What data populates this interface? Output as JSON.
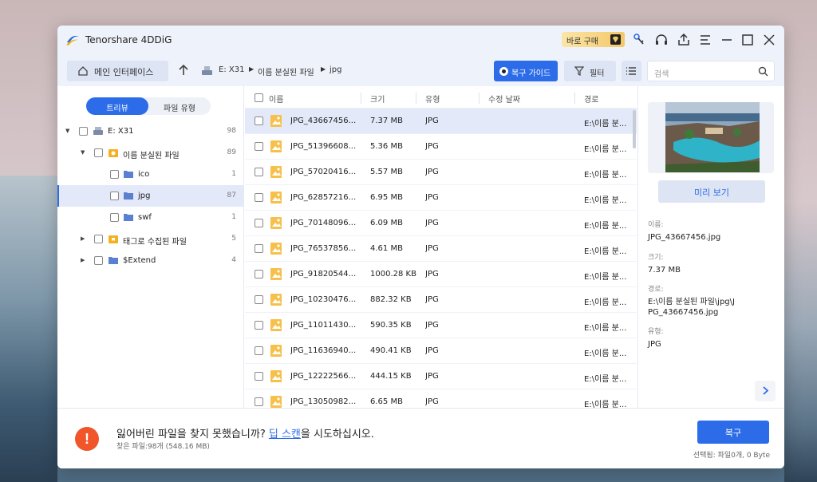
{
  "app": {
    "title": "Tenorshare 4DDiG",
    "buy_label": "바로 구매"
  },
  "toolbar": {
    "home_label": "메인 인터페이스",
    "breadcrumb": [
      "E: X31",
      "이름 분실된 파일",
      "jpg"
    ],
    "guide_label": "복구 가이드",
    "filter_label": "필터",
    "search_placeholder": "검색"
  },
  "sidebar": {
    "tab_tree": "트리뷰",
    "tab_type": "파일 유형",
    "items": [
      {
        "label": "E: X31",
        "count": "98"
      },
      {
        "label": "이름 분실된 파일",
        "count": "89"
      },
      {
        "label": "ico",
        "count": "1"
      },
      {
        "label": "jpg",
        "count": "87"
      },
      {
        "label": "swf",
        "count": "1"
      },
      {
        "label": "태그로 수집된 파일",
        "count": "5"
      },
      {
        "label": "$Extend",
        "count": "4"
      }
    ]
  },
  "list": {
    "columns": [
      "이름",
      "크기",
      "유형",
      "수정 날짜",
      "경로"
    ],
    "rows": [
      {
        "name": "JPG_43667456...",
        "size": "7.37 MB",
        "type": "JPG",
        "date": "",
        "path": "E:\\이름 분..."
      },
      {
        "name": "JPG_51396608...",
        "size": "5.36 MB",
        "type": "JPG",
        "date": "",
        "path": "E:\\이름 분..."
      },
      {
        "name": "JPG_57020416...",
        "size": "5.57 MB",
        "type": "JPG",
        "date": "",
        "path": "E:\\이름 분..."
      },
      {
        "name": "JPG_62857216...",
        "size": "6.95 MB",
        "type": "JPG",
        "date": "",
        "path": "E:\\이름 분..."
      },
      {
        "name": "JPG_70148096...",
        "size": "6.09 MB",
        "type": "JPG",
        "date": "",
        "path": "E:\\이름 분..."
      },
      {
        "name": "JPG_76537856...",
        "size": "4.61 MB",
        "type": "JPG",
        "date": "",
        "path": "E:\\이름 분..."
      },
      {
        "name": "JPG_91820544...",
        "size": "1000.28 KB",
        "type": "JPG",
        "date": "",
        "path": "E:\\이름 분..."
      },
      {
        "name": "JPG_10230476...",
        "size": "882.32 KB",
        "type": "JPG",
        "date": "",
        "path": "E:\\이름 분..."
      },
      {
        "name": "JPG_11011430...",
        "size": "590.35 KB",
        "type": "JPG",
        "date": "",
        "path": "E:\\이름 분..."
      },
      {
        "name": "JPG_11636940...",
        "size": "490.41 KB",
        "type": "JPG",
        "date": "",
        "path": "E:\\이름 분..."
      },
      {
        "name": "JPG_12222566...",
        "size": "444.15 KB",
        "type": "JPG",
        "date": "",
        "path": "E:\\이름 분..."
      },
      {
        "name": "JPG_13050982...",
        "size": "6.65 MB",
        "type": "JPG",
        "date": "",
        "path": "E:\\이름 분..."
      }
    ]
  },
  "details": {
    "preview_label": "미리 보기",
    "name_label": "이름:",
    "name_value": "JPG_43667456.jpg",
    "size_label": "크기:",
    "size_value": "7.37 MB",
    "path_label": "경로:",
    "path_value": "E:\\이름 분실된 파일\\jpg\\JPG_43667456.jpg",
    "type_label": "유형:",
    "type_value": "JPG"
  },
  "footer": {
    "message_before": "잃어버린 파일을 찾지 못했습니까? ",
    "deep_scan_link": "딥 스캔",
    "message_after": "을 시도하십시오.",
    "found_text": "찾은 파일:98개 (548.16 MB)",
    "recover_label": "복구",
    "selected_text": "선택됨: 파일0개, 0 Byte"
  },
  "colors": {
    "accent": "#2c6ce8",
    "warning": "#f0562a",
    "selection": "#e3e9f9"
  }
}
